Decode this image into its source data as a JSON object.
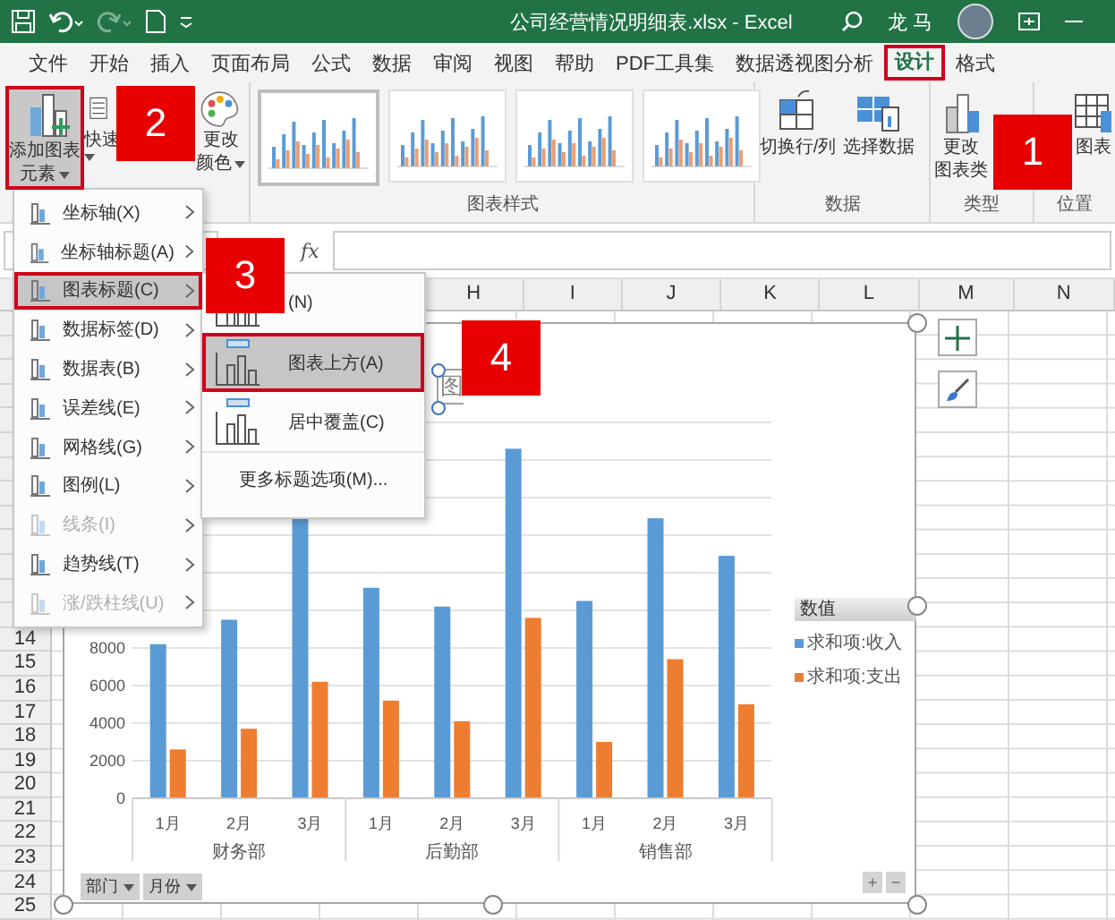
{
  "window": {
    "title": "公司经营情况明细表.xlsx - Excel",
    "user": "龙 马"
  },
  "tabs": [
    {
      "label": "文件",
      "selected": false
    },
    {
      "label": "开始",
      "selected": false
    },
    {
      "label": "插入",
      "selected": false
    },
    {
      "label": "页面布局",
      "selected": false
    },
    {
      "label": "公式",
      "selected": false
    },
    {
      "label": "数据",
      "selected": false
    },
    {
      "label": "审阅",
      "selected": false
    },
    {
      "label": "视图",
      "selected": false
    },
    {
      "label": "帮助",
      "selected": false
    },
    {
      "label": "PDF工具集",
      "selected": false
    },
    {
      "label": "数据透视图分析",
      "selected": false
    },
    {
      "label": "设计",
      "selected": true
    },
    {
      "label": "格式",
      "selected": false
    }
  ],
  "ribbon": {
    "layout_buttons": [
      {
        "lines": [
          "添加图表",
          "元素"
        ],
        "pressed": true,
        "dropdown": true
      },
      {
        "lines": [
          "快速"
        ],
        "pressed": false,
        "dropdown": true
      },
      {
        "lines": [
          "更改",
          "颜色"
        ],
        "pressed": false,
        "dropdown": true
      }
    ],
    "styles": {
      "label": "图表样式",
      "thumbnails": [
        {
          "selected": true
        },
        {
          "selected": false
        },
        {
          "selected": false
        },
        {
          "selected": false
        }
      ]
    },
    "data": {
      "label": "数据",
      "buttons": [
        "切换行/列",
        "选择数据"
      ]
    },
    "type": {
      "label": "类型",
      "button": [
        "更改",
        "图表类"
      ]
    },
    "location": {
      "label": "位置",
      "button": "图表"
    }
  },
  "formula_bar": {
    "fx": "fx"
  },
  "sheet": {
    "columns": [
      "H",
      "I",
      "J",
      "K",
      "L",
      "M",
      "N"
    ],
    "rows": [
      "14",
      "15",
      "16",
      "17",
      "18",
      "19",
      "20",
      "21",
      "22",
      "23",
      "24",
      "25"
    ]
  },
  "chart": {
    "title": "图",
    "chart_data": {
      "type": "bar",
      "categories": [
        "1月",
        "2月",
        "3月",
        "1月",
        "2月",
        "3月",
        "1月",
        "2月",
        "3月"
      ],
      "series": [
        {
          "name": "求和项:收入",
          "color": "#5b9bd5",
          "values": [
            8200,
            9500,
            15000,
            11200,
            10200,
            18600,
            10500,
            14900,
            12900
          ]
        },
        {
          "name": "求和项:支出",
          "color": "#ed7d31",
          "values": [
            2600,
            3700,
            6200,
            5200,
            4100,
            9600,
            3000,
            7400,
            5000
          ]
        }
      ],
      "ylim": [
        0,
        20000
      ],
      "grid": true,
      "yticks": [
        0,
        2000,
        4000,
        6000,
        8000
      ]
    },
    "groups": [
      "财务部",
      "后勤部",
      "销售部"
    ],
    "legend_title": "数值",
    "field_buttons": [
      "部门",
      "月份"
    ],
    "zoom_buttons": [
      "+",
      "−"
    ]
  },
  "element_menu": [
    {
      "label": "坐标轴(X)",
      "selected": false,
      "disabled": false
    },
    {
      "label": "坐标轴标题(A)",
      "selected": false,
      "disabled": false
    },
    {
      "label": "图表标题(C)",
      "selected": true,
      "disabled": false
    },
    {
      "label": "数据标签(D)",
      "selected": false,
      "disabled": false
    },
    {
      "label": "数据表(B)",
      "selected": false,
      "disabled": false
    },
    {
      "label": "误差线(E)",
      "selected": false,
      "disabled": false
    },
    {
      "label": "网格线(G)",
      "selected": false,
      "disabled": false
    },
    {
      "label": "图例(L)",
      "selected": false,
      "disabled": false
    },
    {
      "label": "线条(I)",
      "selected": false,
      "disabled": true
    },
    {
      "label": "趋势线(T)",
      "selected": false,
      "disabled": false
    },
    {
      "label": "涨/跌柱线(U)",
      "selected": false,
      "disabled": true
    }
  ],
  "title_menu": [
    {
      "kind": "option",
      "label": "(N)",
      "selected": false
    },
    {
      "kind": "option",
      "label": "图表上方(A)",
      "selected": true
    },
    {
      "kind": "option",
      "label": "居中覆盖(C)",
      "selected": false
    },
    {
      "kind": "more",
      "label": "更多标题选项(M)...",
      "selected": false
    }
  ],
  "callouts": [
    "1",
    "2",
    "3",
    "4"
  ]
}
